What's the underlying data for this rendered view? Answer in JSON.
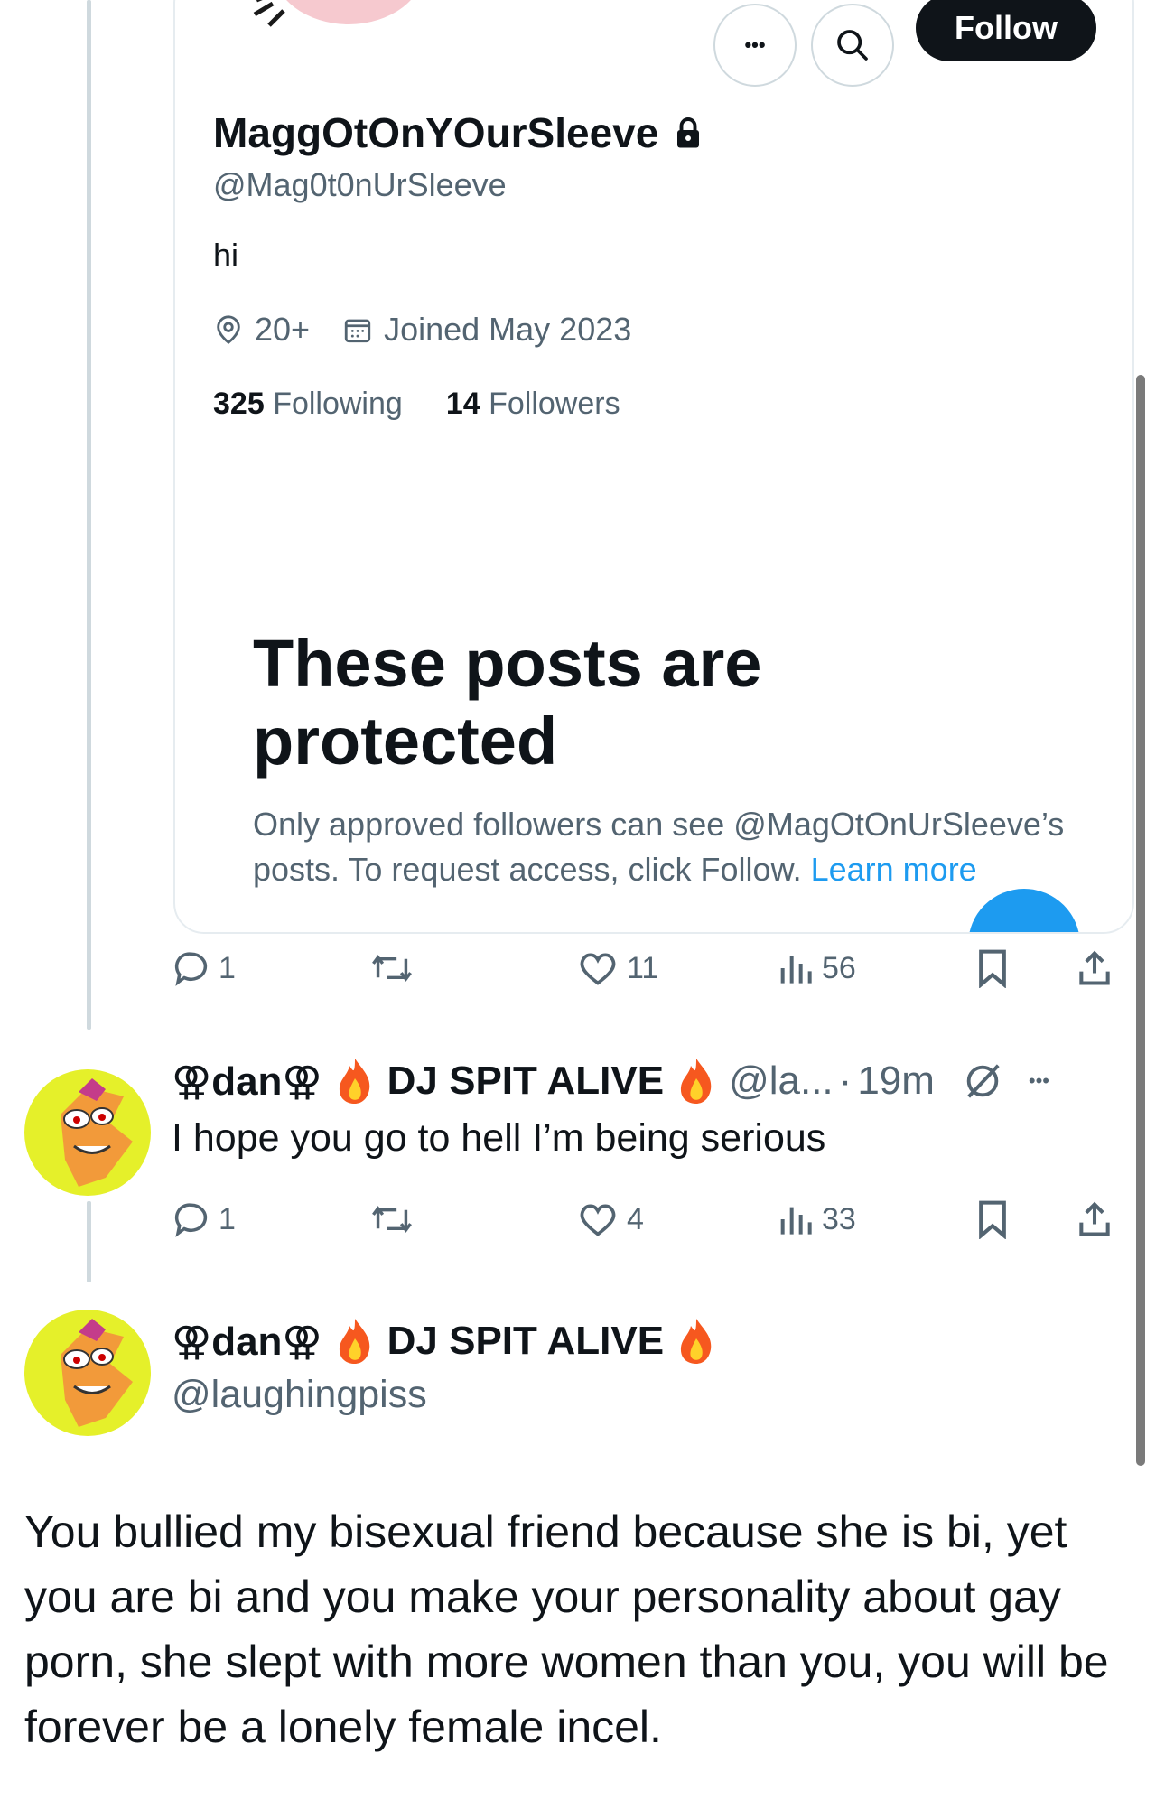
{
  "profile_card": {
    "name": "MaggOtOnYOurSleeve",
    "handle": "@Mag0t0nUrSleeve",
    "bio": "hi",
    "location": "20+",
    "joined": "Joined May 2023",
    "following_count": "325",
    "following_label": "Following",
    "followers_count": "14",
    "followers_label": "Followers",
    "follow_button": "Follow",
    "more_button": "•••",
    "protected_title": "These posts are protected",
    "protected_desc": "Only approved followers can see @MagOtOnUrSleeve’s posts. To request access, click Follow.",
    "learn_more": "Learn more"
  },
  "quoted_actions": {
    "replies": "1",
    "likes": "11",
    "views": "56"
  },
  "reply": {
    "display_name_part1": "⚢dan⚢",
    "display_name_part2": "DJ SPIT ALIVE",
    "handle": "@la...",
    "separator": "·",
    "time": "19m",
    "more": "•••",
    "text": "I hope you go to hell I’m being serious",
    "replies": "1",
    "likes": "4",
    "views": "33"
  },
  "main_post": {
    "display_name_part1": "⚢dan⚢",
    "display_name_part2": "DJ SPIT ALIVE",
    "handle": "@laughingpiss",
    "text": "You bullied my bisexual friend because she is bi, yet you are bi and you make your personality about gay porn, she slept with more women than you, you will be forever be a lonely female incel."
  },
  "colors": {
    "accent": "#1d9bf0",
    "text": "#0f1419",
    "secondary": "#536471",
    "avatar_bg": "#e5f02a"
  }
}
